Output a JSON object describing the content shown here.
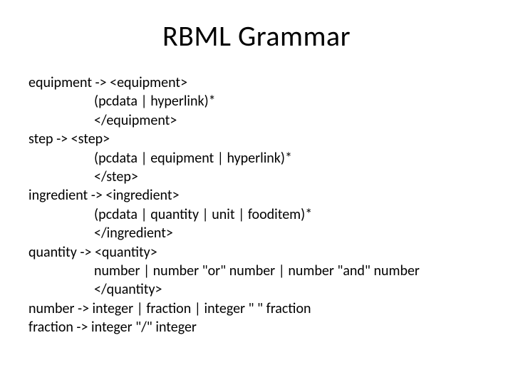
{
  "title": "RBML Grammar",
  "rules": {
    "equipment_head": "equipment -> <equipment>",
    "equipment_body1": "(pcdata | hyperlink)*",
    "equipment_body2": "</equipment>",
    "step_head": "step -> <step>",
    "step_body1": "(pcdata | equipment | hyperlink)*",
    "step_body2": "</step>",
    "ingredient_head": "ingredient -> <ingredient>",
    "ingredient_body1": "(pcdata | quantity | unit | fooditem)*",
    "ingredient_body2": "</ingredient>",
    "quantity_head": "quantity -> <quantity>",
    "quantity_body1": "number | number \"or\" number | number \"and\" number",
    "quantity_body2": "</quantity>",
    "number_head": "number -> integer | fraction | integer \" \" fraction",
    "fraction_head": "fraction -> integer \"/\" integer"
  }
}
